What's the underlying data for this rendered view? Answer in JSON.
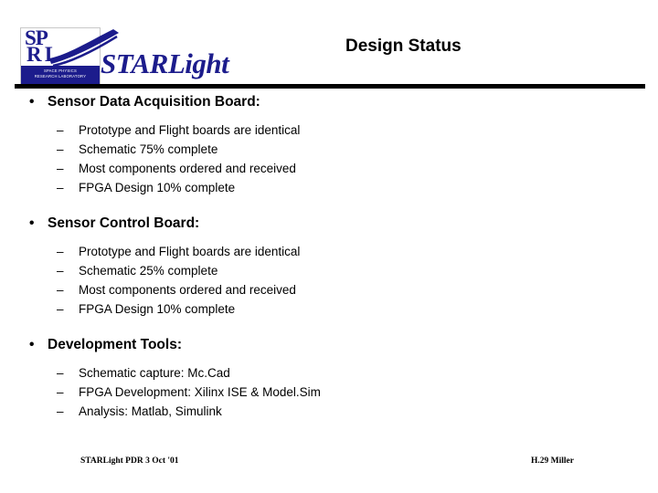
{
  "header": {
    "title": "Design Status",
    "logo": {
      "sp_text": "SP",
      "r_text": "R",
      "l_text": "L",
      "lab_line1": "SPACE PHYSICS",
      "lab_line2": "RESEARCH LABORATORY",
      "wordmark": "STARLight",
      "brand_color": "#1c1c8c"
    }
  },
  "sections": [
    {
      "heading": "Sensor Data Acquisition Board:",
      "items": [
        "Prototype and Flight boards are identical",
        "Schematic 75% complete",
        "Most components ordered and received",
        "FPGA Design 10% complete"
      ]
    },
    {
      "heading": "Sensor Control Board:",
      "items": [
        "Prototype and Flight boards are identical",
        "Schematic 25% complete",
        "Most components ordered and received",
        "FPGA Design 10% complete"
      ]
    },
    {
      "heading": "Development Tools:",
      "items": [
        "Schematic capture: Mc.Cad",
        "FPGA Development: Xilinx ISE & Model.Sim",
        "Analysis:  Matlab, Simulink"
      ]
    }
  ],
  "bullet_glyphs": {
    "level1": "•",
    "level2": "–"
  },
  "footer": {
    "left": "STARLight PDR  3 Oct  '01",
    "right": "H.29  Miller"
  }
}
